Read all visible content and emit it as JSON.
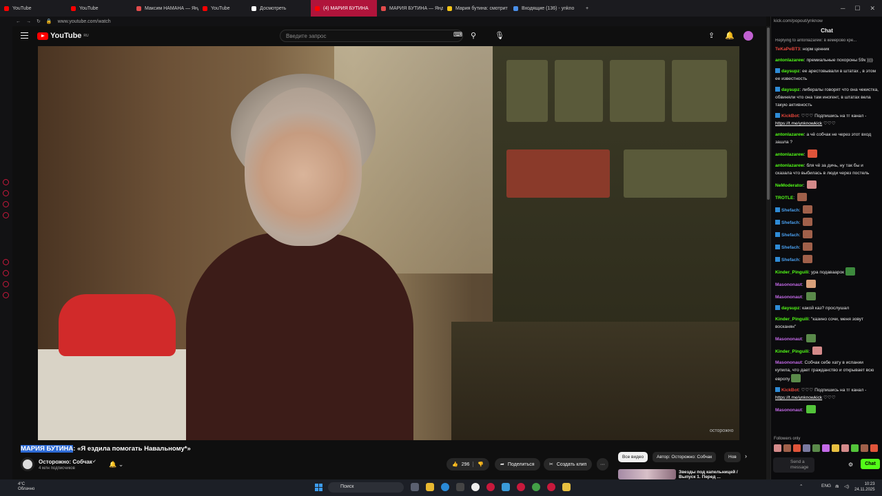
{
  "browser": {
    "tabs": [
      {
        "label": "YouTube",
        "color": "#ff0000"
      },
      {
        "label": "YouTube",
        "color": "#ff0000"
      },
      {
        "label": "Максим НАМАНА — Янде",
        "color": "#e24c4c"
      },
      {
        "label": "YouTube",
        "color": "#ff0000"
      },
      {
        "label": "Досмотреть",
        "color": "#ffffff"
      },
      {
        "label": "(4) МАРИЯ БУТИНА",
        "color": "#ff0000"
      },
      {
        "label": "МАРИЯ БУТИНА — Яндекс",
        "color": "#e24c4c"
      },
      {
        "label": "Мария бутина: смотрит",
        "color": "#f5c518"
      },
      {
        "label": "Входящие (136) - ynkno",
        "color": "#4a8fe8"
      }
    ],
    "new_tab": "+",
    "url": "www.youtube.com/watch",
    "chat_url": "kick.com/popout/ynknow"
  },
  "youtube": {
    "logo": "YouTube",
    "region": "RU",
    "search_placeholder": "Введите запрос",
    "video_title_highlight": "МАРИЯ БУТИНА",
    "video_title_rest": ": «Я ездила помогать Навальному*»",
    "channel_name": "Осторожно: Собчак",
    "subscribers": "4 млн подписчиков",
    "likes": "296",
    "share_label": "Поделиться",
    "clip_label": "Создать клип",
    "more": "···",
    "watermark": "осторожно",
    "chips": [
      "Все видео",
      "Автор: Осторожно: Собчак",
      "Нов"
    ],
    "rec_title": "Звезды под капельницей / Выпуск 1. Перед ...",
    "accent": "#ff0000"
  },
  "chat": {
    "header": "Chat",
    "reply_note": "Replying to antonlazarew: в кемерово кре...",
    "messages": [
      {
        "user": "TeKaPeBT3",
        "color": "#e8473c",
        "badge": false,
        "text": "норм ценник"
      },
      {
        "user": "antonlazarew",
        "color": "#53fc18",
        "badge": false,
        "text": "премиальные похороны 59к ))))"
      },
      {
        "user": "daysupz",
        "color": "#53fc18",
        "badge": true,
        "text": "ее арестовывали в штатах , в этом ее известность"
      },
      {
        "user": "daysupz",
        "color": "#53fc18",
        "badge": true,
        "text": "либералы говорят что она чекистка, обвиняли что она там иногент, в штатах вела такую активность"
      },
      {
        "user": "KickBot",
        "color": "#e8473c",
        "badge": true,
        "text": "♡♡♡ Подпишись на тг канал - ",
        "link": "https://t.me/ynknowkick",
        "after": " ♡♡♡"
      },
      {
        "user": "antonlazarew",
        "color": "#53fc18",
        "badge": false,
        "text": "а чё собчак не через этот вход зашла ?"
      },
      {
        "user": "antonlazarew",
        "color": "#53fc18",
        "badge": false,
        "text": "",
        "emote": "#e0543a"
      },
      {
        "user": "antonlazarew",
        "color": "#53fc18",
        "badge": false,
        "text": "бля чё за дичь, ну так бы и сказала что выбилась в люди через постель"
      },
      {
        "user": "NeModerator",
        "color": "#53fc18",
        "badge": false,
        "text": "",
        "emote": "#d48a8a"
      },
      {
        "user": "TROTLE",
        "color": "#53fc18",
        "badge": false,
        "text": "",
        "emote": "#a0604a"
      },
      {
        "user": "Shefach",
        "color": "#4aa0f0",
        "badge": true,
        "text": "",
        "emote": "#a0604a"
      },
      {
        "user": "Shefach",
        "color": "#4aa0f0",
        "badge": true,
        "text": "",
        "emote": "#a0604a"
      },
      {
        "user": "Shefach",
        "color": "#4aa0f0",
        "badge": true,
        "text": "",
        "emote": "#a0604a"
      },
      {
        "user": "Shefach",
        "color": "#4aa0f0",
        "badge": true,
        "text": "",
        "emote": "#a0604a"
      },
      {
        "user": "Shefach",
        "color": "#4aa0f0",
        "badge": true,
        "text": "",
        "emote": "#a0604a"
      },
      {
        "user": "Kinder_Pinguili",
        "color": "#53fc18",
        "badge": false,
        "text": "ура подаваарок",
        "emote": "#3d8a3d"
      },
      {
        "user": "Masononaut",
        "color": "#c46ae8",
        "badge": false,
        "text": "",
        "emote": "#d9a07a"
      },
      {
        "user": "Masononaut",
        "color": "#c46ae8",
        "badge": false,
        "text": "",
        "emote": "#5a8a4a"
      },
      {
        "user": "daysupz",
        "color": "#53fc18",
        "badge": true,
        "text": "какой каз? прослушал"
      },
      {
        "user": "Kinder_Pinguili",
        "color": "#53fc18",
        "badge": false,
        "text": "\"казино сочи, меня зовут восканян\""
      },
      {
        "user": "Masononaut",
        "color": "#c46ae8",
        "badge": false,
        "text": "",
        "emote": "#5a8a4a"
      },
      {
        "user": "Kinder_Pinguili",
        "color": "#53fc18",
        "badge": false,
        "text": "",
        "emote": "#d48a8a"
      },
      {
        "user": "Masononaut",
        "color": "#c46ae8",
        "badge": false,
        "text": "Собчак себе хату в испании купила, что дает гражданство и открывает всю европу",
        "emote": "#5a8a4a"
      },
      {
        "user": "KickBot",
        "color": "#e8473c",
        "badge": true,
        "text": "♡♡♡ Подпишись на тг канал - ",
        "link": "https://t.me/ynknowkick",
        "after": " ♡♡♡"
      },
      {
        "user": "Masononaut",
        "color": "#c46ae8",
        "badge": false,
        "text": "",
        "emote": "#53c43a"
      }
    ],
    "followers_only": "Followers only",
    "send_placeholder": "Send a message",
    "chat_button": "Chat",
    "accent": "#53fc18"
  },
  "taskbar": {
    "weather_temp": "4°C",
    "weather_desc": "Облачно",
    "search": "Поиск",
    "lang": "ENG",
    "time": "10:23",
    "date": "24.11.2025"
  }
}
